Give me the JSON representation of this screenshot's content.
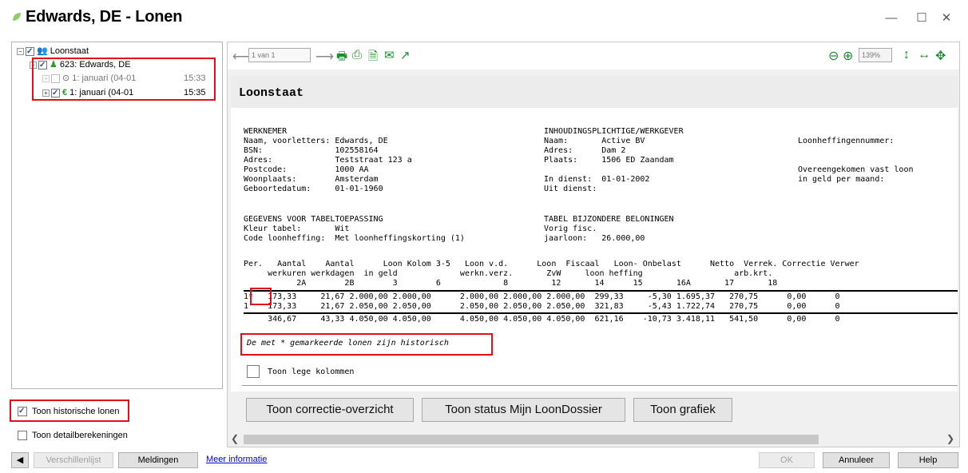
{
  "window": {
    "title": "Edwards, DE - Lonen",
    "minimize": "—",
    "maximize": "☐",
    "close": "✕"
  },
  "tree": {
    "root": "Loonstaat",
    "employee": "623: Edwards, DE",
    "periods": [
      {
        "label": "1: januari (04-01",
        "time": "15:33",
        "checked": false
      },
      {
        "label": "1: januari (04-01",
        "time": "15:35",
        "checked": true
      }
    ]
  },
  "left_options": {
    "historic": "Toon historische lonen",
    "detail": "Toon detailberekeningen"
  },
  "toolbar": {
    "page": "1 van 1",
    "zoom": "139%"
  },
  "report": {
    "title": "Loonstaat",
    "werknemer_block": "WERKNEMER\nNaam, voorletters: Edwards, DE\nBSN:               102558164\nAdres:             Teststraat 123 a\nPostcode:          1000 AA\nWoonplaats:        Amsterdam\nGeboortedatum:     01-01-1960",
    "werkgever_block": "INHOUDINGSPLICHTIGE/WERKGEVER\nNaam:       Active BV\nAdres:      Dam 2\nPlaats:     1506 ED Zaandam\n\nIn dienst:  01-01-2002\nUit dienst:",
    "right_block": "\nLoonheffingennummer:\n\n\nOvereengekomen vast loon\nin geld per maand:",
    "tabel_block": "GEGEVENS VOOR TABELTOEPASSING\nKleur tabel:       Wit\nCode loonheffing:  Met loonheffingskorting (1)",
    "bijzonder_block": "TABEL BIJZONDERE BELONINGEN\nVorig fisc.\njaarloon:   26.000,00",
    "table_header": "Per.   Aantal    Aantal      Loon Kolom 3-5   Loon v.d.      Loon  Fiscaal   Loon- Onbelast      Netto  Verrek. Correctie Verwer\n     werkuren werkdagen  in geld             werkn.verz.       ZvW     loon heffing                   arb.krt.\n           2A        2B        3        6             8         12       14      15       16A       17       18",
    "rows": [
      "1*   173,33     21,67 2.000,00 2.000,00      2.000,00 2.000,00 2.000,00  299,33     -5,30 1.695,37   270,75      0,00      0",
      "1    173,33     21,67 2.050,00 2.050,00      2.050,00 2.050,00 2.050,00  321,83     -5,43 1.722,74   270,75      0,00      0"
    ],
    "total_row": "     346,67     43,33 4.050,00 4.050,00      4.050,00 4.050,00 4.050,00  621,16    -10,73 3.418,11   541,50      0,00      0",
    "note": "De met * gemarkeerde lonen zijn historisch",
    "empty_columns": "Toon lege kolommen"
  },
  "buttons": {
    "correction": "Toon correctie-overzicht",
    "status": "Toon status Mijn LoonDossier",
    "chart": "Toon grafiek"
  },
  "bottom": {
    "diff": "Verschillenlijst",
    "messages": "Meldingen",
    "more_info": "Meer informatie",
    "ok": "OK",
    "cancel": "Annuleer",
    "help": "Help"
  }
}
